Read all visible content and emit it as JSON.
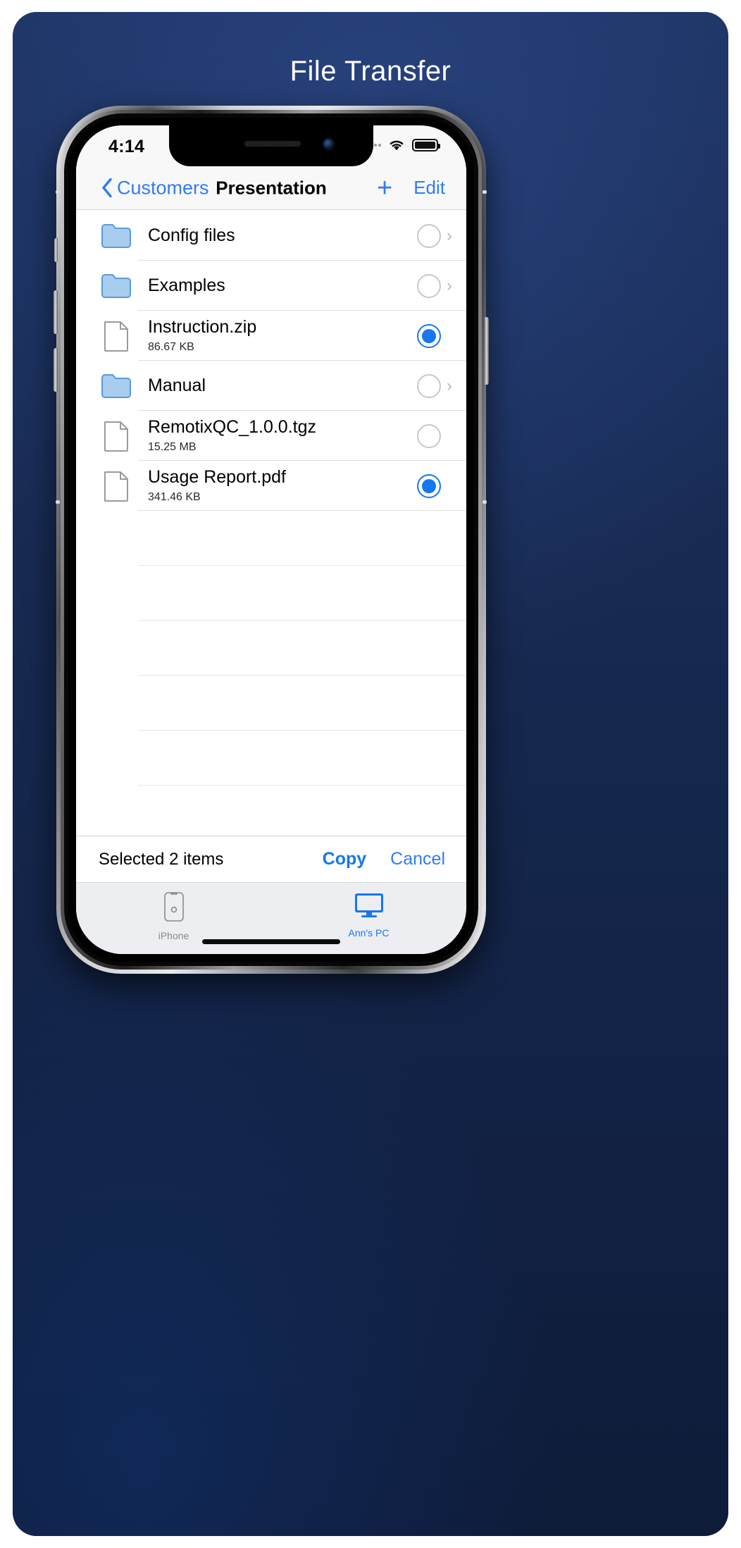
{
  "poster": {
    "title": "File Transfer",
    "background_color": "#16294f"
  },
  "statusbar": {
    "time": "4:14",
    "cellular_icon": "signal-dots-icon",
    "wifi_icon": "wifi-icon",
    "battery_icon": "battery-full-icon"
  },
  "navbar": {
    "back_label": "Customers",
    "back_icon": "chevron-left-icon",
    "title": "Presentation",
    "add_label": "+",
    "add_icon": "plus-icon",
    "edit_label": "Edit"
  },
  "colors": {
    "accent": "#1577f2",
    "link": "#2f7cf6",
    "folder_fill": "#a9cdef",
    "folder_stroke": "#5b9ad8"
  },
  "list": {
    "rows": [
      {
        "name": "Config files",
        "size": "",
        "kind": "folder",
        "icon": "folder-icon",
        "selected": false,
        "has_chevron": true,
        "show_check": true
      },
      {
        "name": "Examples",
        "size": "",
        "kind": "folder",
        "icon": "folder-icon",
        "selected": false,
        "has_chevron": true,
        "show_check": true
      },
      {
        "name": "Instruction.zip",
        "size": "86.67 KB",
        "kind": "file",
        "icon": "document-icon",
        "selected": true,
        "has_chevron": false,
        "show_check": true
      },
      {
        "name": "Manual",
        "size": "",
        "kind": "folder",
        "icon": "folder-icon",
        "selected": false,
        "has_chevron": true,
        "show_check": true
      },
      {
        "name": "RemotixQC_1.0.0.tgz",
        "size": "15.25 MB",
        "kind": "file",
        "icon": "document-icon",
        "selected": false,
        "has_chevron": false,
        "show_check": true
      },
      {
        "name": "Usage Report.pdf",
        "size": "341.46 KB",
        "kind": "file",
        "icon": "document-icon",
        "selected": true,
        "has_chevron": false,
        "show_check": true
      }
    ],
    "empty_row_count": 6
  },
  "toolbar": {
    "status_text": "Selected 2 items",
    "copy_label": "Copy",
    "cancel_label": "Cancel"
  },
  "tabbar": {
    "tabs": [
      {
        "label": "iPhone",
        "icon": "iphone-icon",
        "active": false
      },
      {
        "label": "Ann's PC",
        "icon": "monitor-icon",
        "active": true
      }
    ]
  }
}
